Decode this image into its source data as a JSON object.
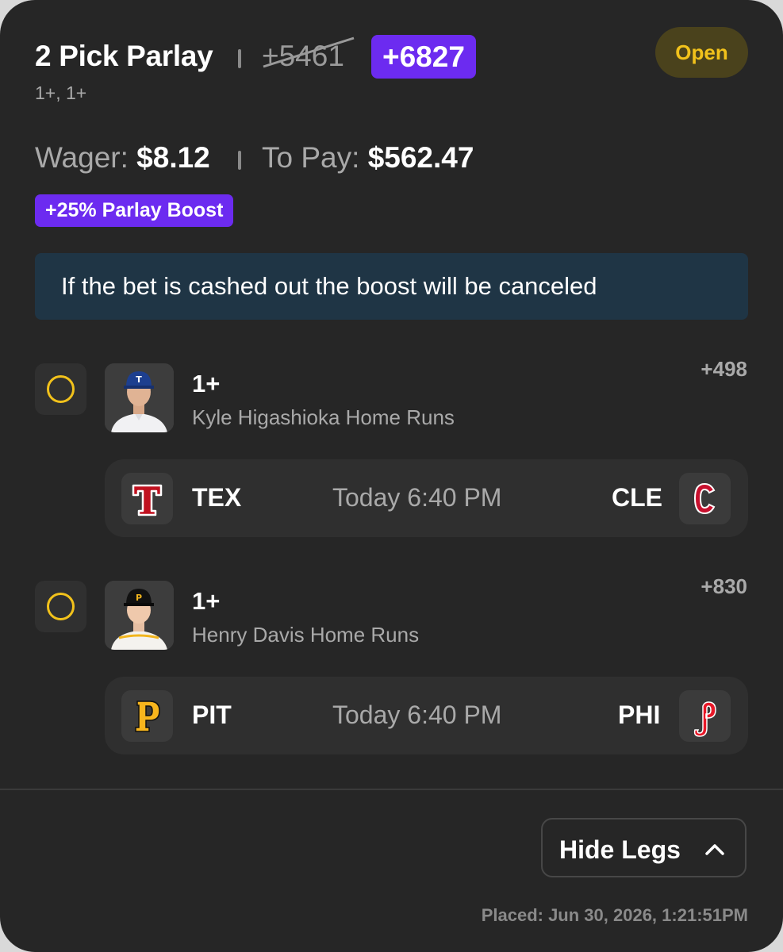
{
  "header": {
    "title": "2 Pick Parlay",
    "original_odds": "+5461",
    "boosted_odds": "+6827",
    "status": "Open",
    "subtitle": "1+, 1+"
  },
  "wager": {
    "wager_label": "Wager:",
    "wager_value": "$8.12",
    "payout_label": "To Pay:",
    "payout_value": "$562.47"
  },
  "boost": {
    "badge": "+25% Parlay Boost",
    "notice": "If the bet is cashed out the boost will be canceled"
  },
  "legs": [
    {
      "line": "1+",
      "market": "Kyle Higashioka Home Runs",
      "odds": "+498",
      "game": {
        "away": "TEX",
        "time": "Today 6:40 PM",
        "home": "CLE"
      }
    },
    {
      "line": "1+",
      "market": "Henry Davis Home Runs",
      "odds": "+830",
      "game": {
        "away": "PIT",
        "time": "Today 6:40 PM",
        "home": "PHI"
      }
    }
  ],
  "footer": {
    "toggle_label": "Hide Legs",
    "placed": "Placed: Jun 30, 2026, 1:21:51PM"
  },
  "colors": {
    "background": "#262626",
    "accent_purple": "#6c2bf0",
    "status_yellow": "#f2c21b",
    "notice_bg": "#1f3545"
  }
}
